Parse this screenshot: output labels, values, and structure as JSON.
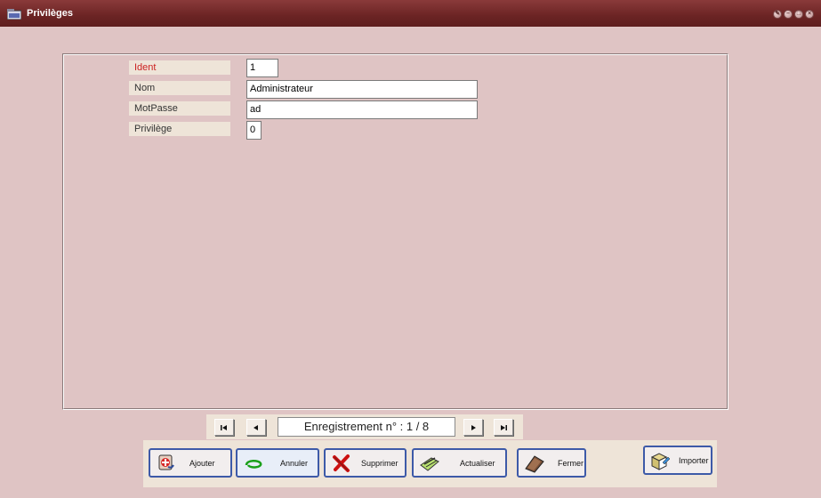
{
  "window": {
    "title": "Privilèges",
    "controls": [
      "settings",
      "minimize",
      "maximize",
      "close"
    ]
  },
  "form": {
    "fields": [
      {
        "label": "Ident",
        "value": "1",
        "label_color": "#cc2222"
      },
      {
        "label": "Nom",
        "value": "Administrateur"
      },
      {
        "label": "MotPasse",
        "value": "ad"
      },
      {
        "label": "Privilège",
        "value": "0"
      }
    ]
  },
  "navigation": {
    "first_icon": "first-record-icon",
    "prev_icon": "previous-record-icon",
    "record_info": "Enregistrement n° : 1 / 8",
    "next_icon": "next-record-icon",
    "last_icon": "last-record-icon"
  },
  "toolbar": {
    "add_label": "Ajouter",
    "cancel_label": "Annuler",
    "delete_label": "Supprimer",
    "refresh_label": "Actualiser",
    "close_label": "Fermer",
    "import_label": "Importer"
  },
  "colors": {
    "background": "#dfc4c4",
    "titlebar": "#6b2424",
    "button_border": "#3d5aa8",
    "required_label": "#cc2222"
  }
}
